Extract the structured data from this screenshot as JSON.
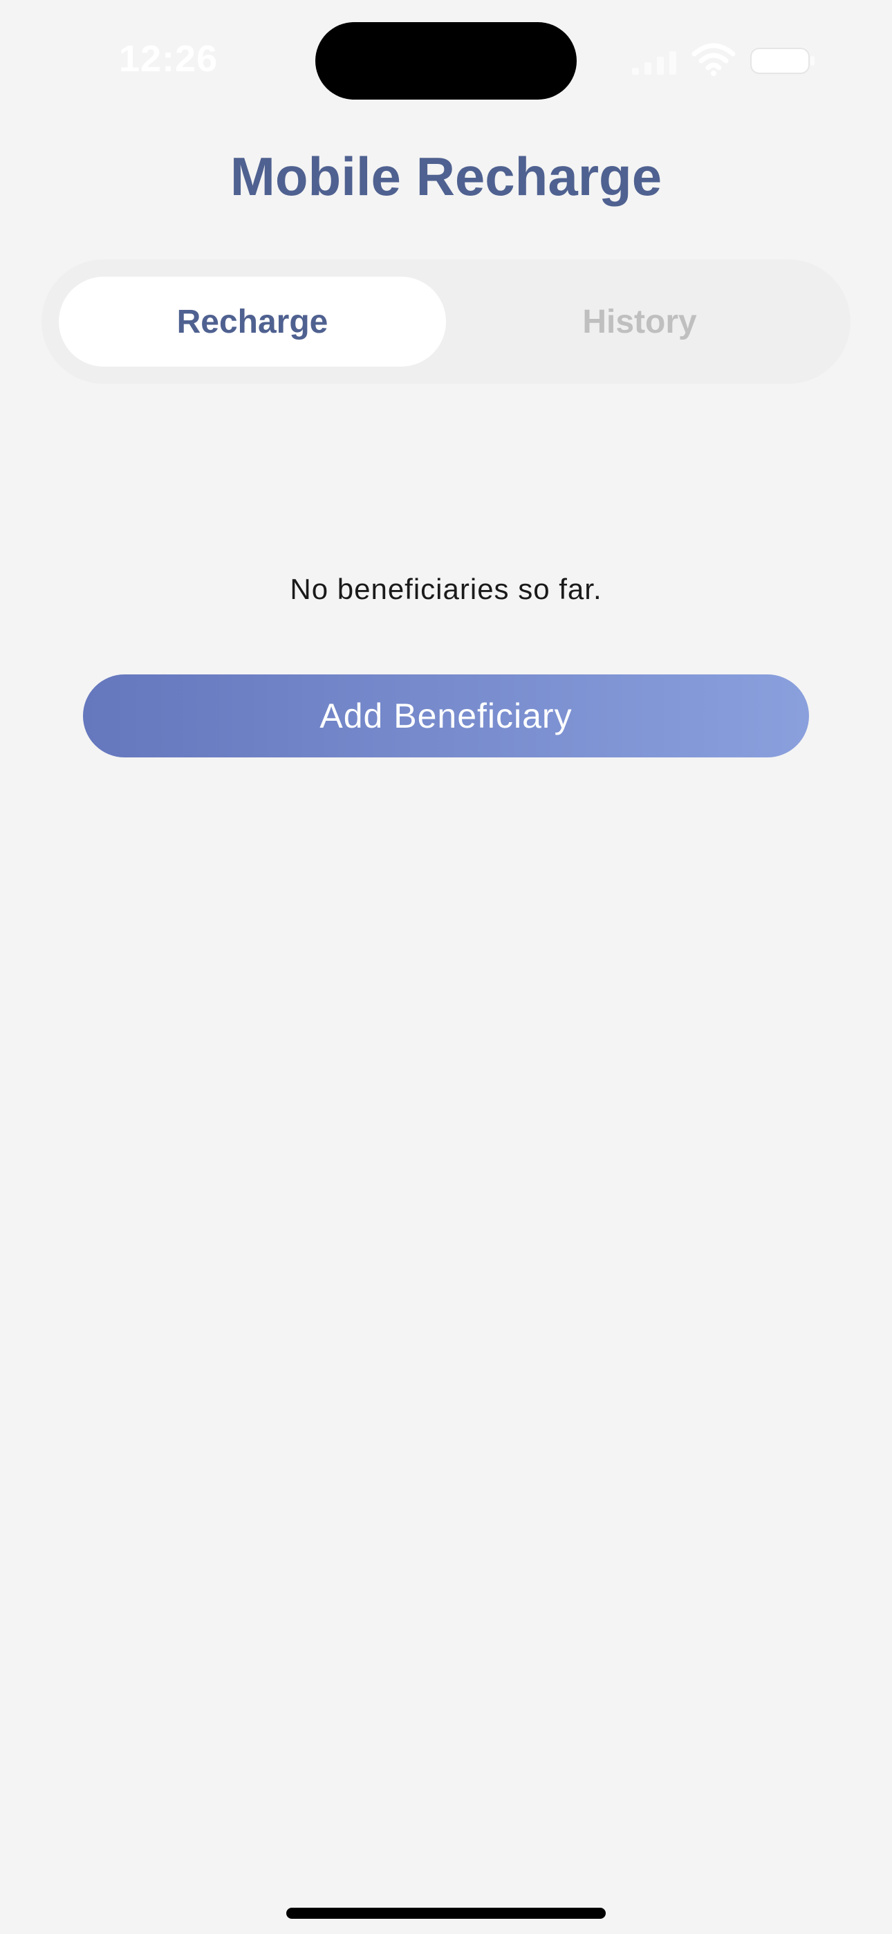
{
  "status_bar": {
    "time": "12:26",
    "icons": [
      "signal-icon",
      "wifi-icon",
      "battery-icon"
    ]
  },
  "header": {
    "title": "Mobile Recharge"
  },
  "tabs": [
    {
      "label": "Recharge",
      "selected": true
    },
    {
      "label": "History",
      "selected": false
    }
  ],
  "empty_state": {
    "message": "No beneficiaries so far.",
    "button_label": "Add Beneficiary"
  },
  "colors": {
    "title": "#4f6190",
    "background": "#f4f4f4",
    "button_gradient_start": "#6577bd",
    "button_gradient_end": "#8aa0dd",
    "inactive_tab": "#bfbfbf"
  }
}
